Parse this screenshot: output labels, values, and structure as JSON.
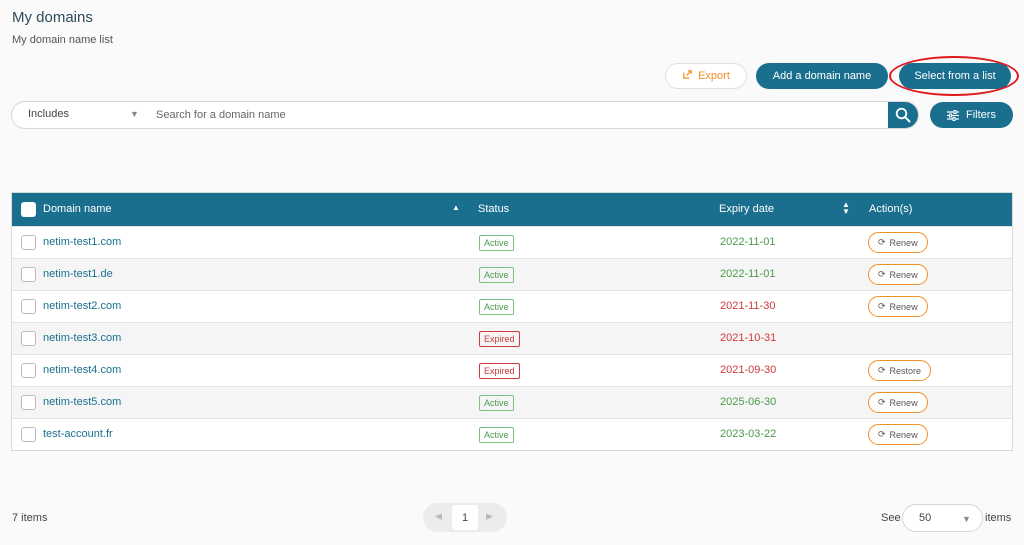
{
  "page": {
    "title": "My domains",
    "subtitle": "My domain name list"
  },
  "toolbar": {
    "export_label": "Export",
    "add_label": "Add a domain name",
    "select_label": "Select from a list",
    "filters_label": "Filters"
  },
  "search": {
    "mode": "Includes",
    "placeholder": "Search for a domain name",
    "value": ""
  },
  "table": {
    "headers": {
      "domain": "Domain name",
      "status": "Status",
      "expiry": "Expiry date",
      "actions": "Action(s)"
    },
    "rows": [
      {
        "domain": "netim-test1.com",
        "status": "Active",
        "expiry": "2022-11-01",
        "action": "Renew"
      },
      {
        "domain": "netim-test1.de",
        "status": "Active",
        "expiry": "2022-11-01",
        "action": "Renew"
      },
      {
        "domain": "netim-test2.com",
        "status": "Active",
        "expiry": "2021-11-30",
        "action": "Renew"
      },
      {
        "domain": "netim-test3.com",
        "status": "Expired",
        "expiry": "2021-10-31",
        "action": ""
      },
      {
        "domain": "netim-test4.com",
        "status": "Expired",
        "expiry": "2021-09-30",
        "action": "Restore"
      },
      {
        "domain": "netim-test5.com",
        "status": "Active",
        "expiry": "2025-06-30",
        "action": "Renew"
      },
      {
        "domain": "test-account.fr",
        "status": "Active",
        "expiry": "2023-03-22",
        "action": "Renew"
      }
    ]
  },
  "footer": {
    "items_count": "7 items",
    "page": "1",
    "see_label": "See",
    "per_page": "50",
    "items_label": "items"
  },
  "colors": {
    "primary": "#1a6f8e",
    "accent": "#f0902a",
    "active": "#4a9b4a",
    "expired": "#d0393e",
    "highlight": "#e0191e"
  },
  "icons": {
    "export": "export-icon",
    "search": "search-icon",
    "filters": "sliders-icon",
    "renew": "refresh-icon",
    "sort_asc": "sort-up-icon",
    "sort_both": "sort-both-icon"
  }
}
